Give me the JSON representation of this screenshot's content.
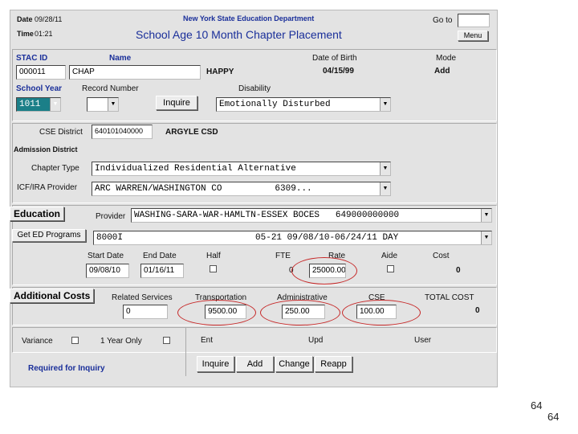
{
  "header": {
    "date_label": "Date",
    "date_value": "09/28/11",
    "time_label": "Time",
    "time_value": "01:21",
    "department": "New York State Education Department",
    "title": "School Age 10 Month Chapter Placement",
    "goto_label": "Go to",
    "goto_value": "",
    "menu_label": "Menu"
  },
  "student": {
    "stac_id_label": "STAC ID",
    "stac_id_value": "000011",
    "name_label": "Name",
    "last_name": "CHAP",
    "first_name": "HAPPY",
    "dob_label": "Date of Birth",
    "dob_value": "04/15/99",
    "mode_label": "Mode",
    "mode_value": "Add",
    "school_year_label": "School Year",
    "school_year_value": "1011",
    "record_number_label": "Record Number",
    "record_number_value": "",
    "inquire_label": "Inquire",
    "disability_label": "Disability",
    "disability_value": "Emotionally Disturbed"
  },
  "district": {
    "cse_label": "CSE District",
    "cse_code": "640101040000",
    "cse_name": "ARGYLE CSD",
    "admission_label": "Admission District",
    "chapter_type_label": "Chapter Type",
    "chapter_type_value": "Individualized Residential Alternative",
    "icf_label": "ICF/IRA Provider",
    "icf_value": "ARC WARREN/WASHINGTON CO          6309..."
  },
  "education": {
    "section_label": "Education",
    "get_programs_label": "Get ED Programs",
    "provider_label": "Provider",
    "provider_value": "WASHING-SARA-WAR-HAMLTN-ESSEX BOCES   649000000000",
    "program_value": "8000I                         05-21 09/08/10-06/24/11 DAY",
    "start_label": "Start Date",
    "start_value": "09/08/10",
    "end_label": "End Date",
    "end_value": "01/16/11",
    "half_label": "Half",
    "fte_label": "FTE",
    "fte_value": "0",
    "rate_label": "Rate",
    "rate_value": "25000.00",
    "aide_label": "Aide",
    "cost_label": "Cost",
    "cost_value": "0"
  },
  "additional": {
    "section_label": "Additional Costs",
    "related_label": "Related Services",
    "related_value": "0",
    "transport_label": "Transportation",
    "transport_value": "9500.00",
    "admin_label": "Administrative",
    "admin_value": "250.00",
    "cse_label": "CSE",
    "cse_value": "100.00",
    "total_label": "TOTAL COST",
    "total_value": "0"
  },
  "footer": {
    "variance_label": "Variance",
    "one_year_label": "1 Year Only",
    "ent_label": "Ent",
    "upd_label": "Upd",
    "user_label": "User",
    "required_note": "Required for Inquiry",
    "buttons": [
      "Inquire",
      "Add",
      "Change",
      "Reapp"
    ]
  },
  "page_numbers": [
    "64",
    "64"
  ],
  "colors": {
    "label_blue": "#1a2f9a",
    "annotation_red": "#c62828",
    "form_gray": "#e3e3e3"
  }
}
